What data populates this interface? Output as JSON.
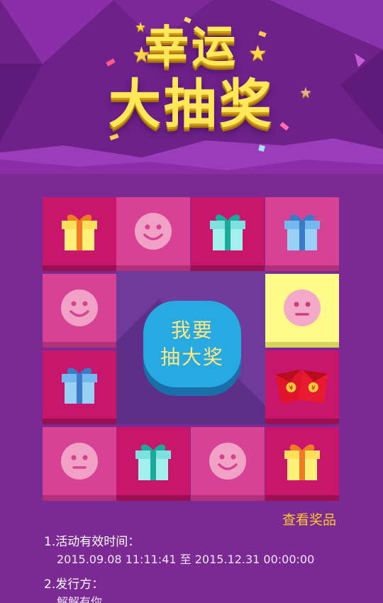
{
  "banner": {
    "title_line1": "幸运",
    "title_line2": "大抽奖"
  },
  "board": {
    "cells": [
      {
        "icon": "gift-yellow-icon",
        "bg": "magenta"
      },
      {
        "icon": "smiley-face-icon",
        "bg": "pink"
      },
      {
        "icon": "gift-teal-icon",
        "bg": "magenta"
      },
      {
        "icon": "gift-blue-icon",
        "bg": "pink"
      },
      {
        "icon": "neutral-face-icon",
        "bg": "yellow"
      },
      {
        "icon": "red-envelopes-icon",
        "bg": "magenta"
      },
      {
        "icon": "gift-yellow-icon",
        "bg": "magenta"
      },
      {
        "icon": "smiley-face-icon",
        "bg": "pink"
      },
      {
        "icon": "gift-teal-icon",
        "bg": "magenta"
      },
      {
        "icon": "neutral-face-icon",
        "bg": "pink"
      },
      {
        "icon": "gift-blue-icon",
        "bg": "magenta"
      },
      {
        "icon": "smiley-face-icon",
        "bg": "pink"
      }
    ],
    "draw_button": {
      "line1": "我要",
      "line2": "抽大奖"
    }
  },
  "view_prizes_label": "查看奖品",
  "rules": {
    "item1_heading": "1.活动有效时间：",
    "item1_value": "2015.09.08 11:11:41 至 2015.12.31 00:00:00",
    "item2_heading": "2.发行方：",
    "item2_value": "解解有你"
  },
  "colors": {
    "background": "#7a2a92",
    "title": "#ffe85a",
    "accent_link": "#ffc62e",
    "button": "#27a9e1",
    "cell_magenta": "#c9166d",
    "cell_pink": "#d84294",
    "cell_highlight": "#fffb8a"
  }
}
